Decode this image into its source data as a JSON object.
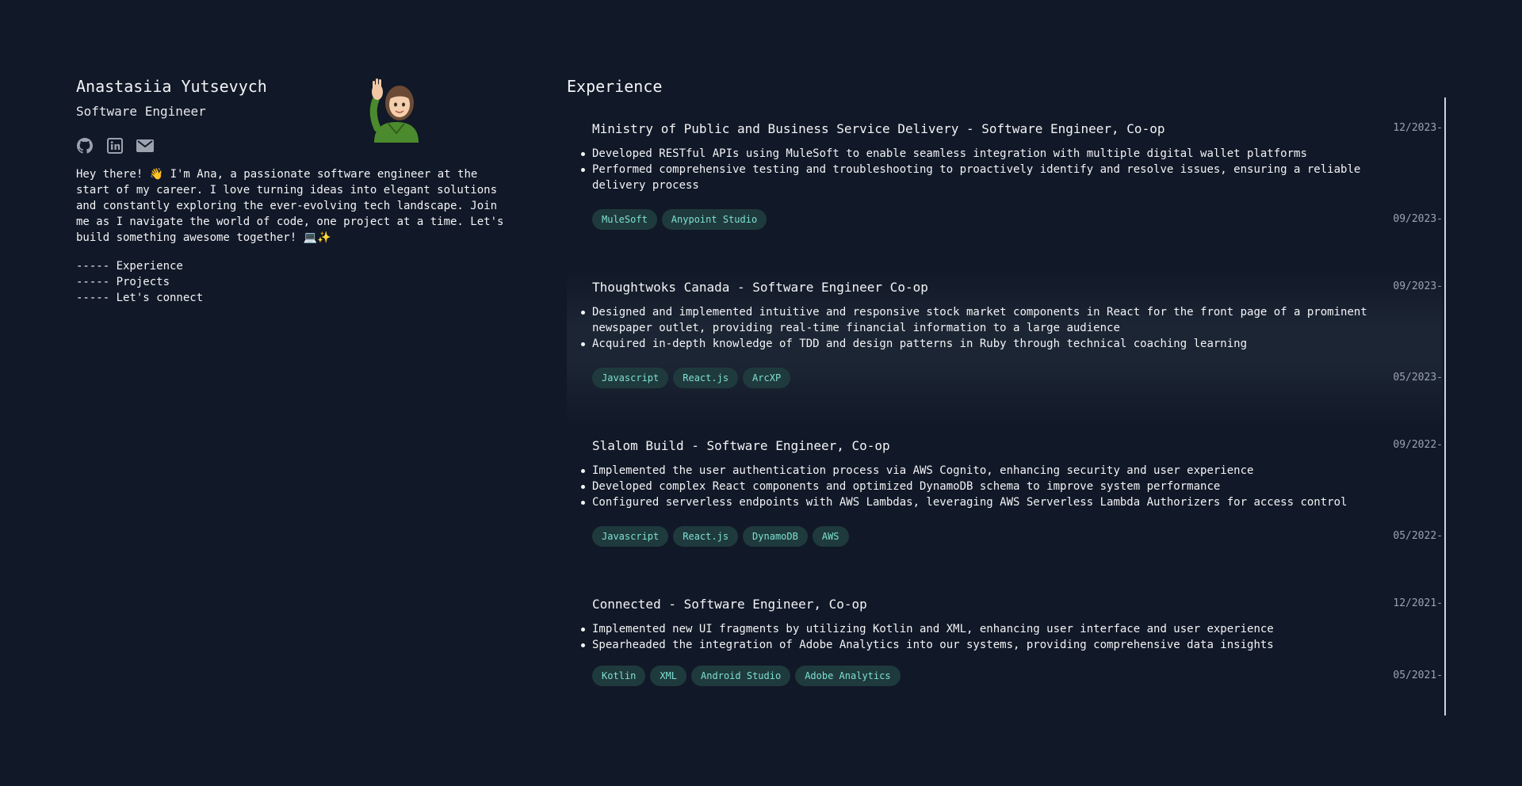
{
  "profile": {
    "name": "Anastasiia Yutsevych",
    "role": "Software Engineer",
    "bio": "Hey there! 👋 I'm Ana, a passionate software engineer at the start of my career. I love turning ideas into elegant solutions and constantly exploring the ever-evolving tech landscape. Join me as I navigate the world of code, one project at a time. Let's build something awesome together! 💻✨",
    "socials": [
      {
        "icon": "github-icon"
      },
      {
        "icon": "linkedin-icon"
      },
      {
        "icon": "mail-icon"
      }
    ]
  },
  "nav": {
    "items": [
      "----- Experience",
      "----- Projects",
      "----- Let's connect"
    ]
  },
  "experience": {
    "title": "Experience",
    "entries": [
      {
        "title": "Ministry of Public and Business Service Delivery - Software Engineer, Co-op",
        "bullets": [
          "Developed RESTful APIs using MuleSoft to enable seamless integration with multiple digital wallet platforms",
          "Performed comprehensive testing and troubleshooting to proactively identify and resolve issues, ensuring a reliable delivery process"
        ],
        "tags": [
          "MuleSoft",
          "Anypoint Studio"
        ],
        "date_end": "12/2023-",
        "date_start": "09/2023-"
      },
      {
        "title": "Thoughtwoks Canada - Software Engineer Co-op",
        "bullets": [
          "Designed and implemented intuitive and responsive stock market components in React for the front page of a prominent newspaper outlet, providing real-time financial information to a large audience",
          "Acquired in-depth knowledge of TDD and design patterns in Ruby through technical coaching learning"
        ],
        "tags": [
          "Javascript",
          "React.js",
          "ArcXP"
        ],
        "date_end": "09/2023-",
        "date_start": "05/2023-"
      },
      {
        "title": "Slalom Build - Software Engineer, Co-op",
        "bullets": [
          "Implemented the user authentication process via AWS Cognito, enhancing security and user experience",
          "Developed complex React components and optimized DynamoDB schema to improve system performance",
          "Configured serverless endpoints with AWS Lambdas, leveraging AWS Serverless Lambda Authorizers for access control"
        ],
        "tags": [
          "Javascript",
          "React.js",
          "DynamoDB",
          "AWS"
        ],
        "date_end": "09/2022-",
        "date_start": "05/2022-"
      },
      {
        "title": "Connected - Software Engineer, Co-op",
        "bullets": [
          "Implemented new UI fragments by utilizing Kotlin and XML, enhancing user interface and user experience",
          "Spearheaded the integration of Adobe Analytics into our systems, providing comprehensive data insights"
        ],
        "tags": [
          "Kotlin",
          "XML",
          "Android Studio",
          "Adobe Analytics"
        ],
        "date_end": "12/2021-",
        "date_start": "05/2021-"
      }
    ]
  },
  "colors": {
    "background": "#111827",
    "tag_bg": "#1f3a3d",
    "tag_text": "#7ee0d2",
    "date_text": "#9ca3af"
  }
}
